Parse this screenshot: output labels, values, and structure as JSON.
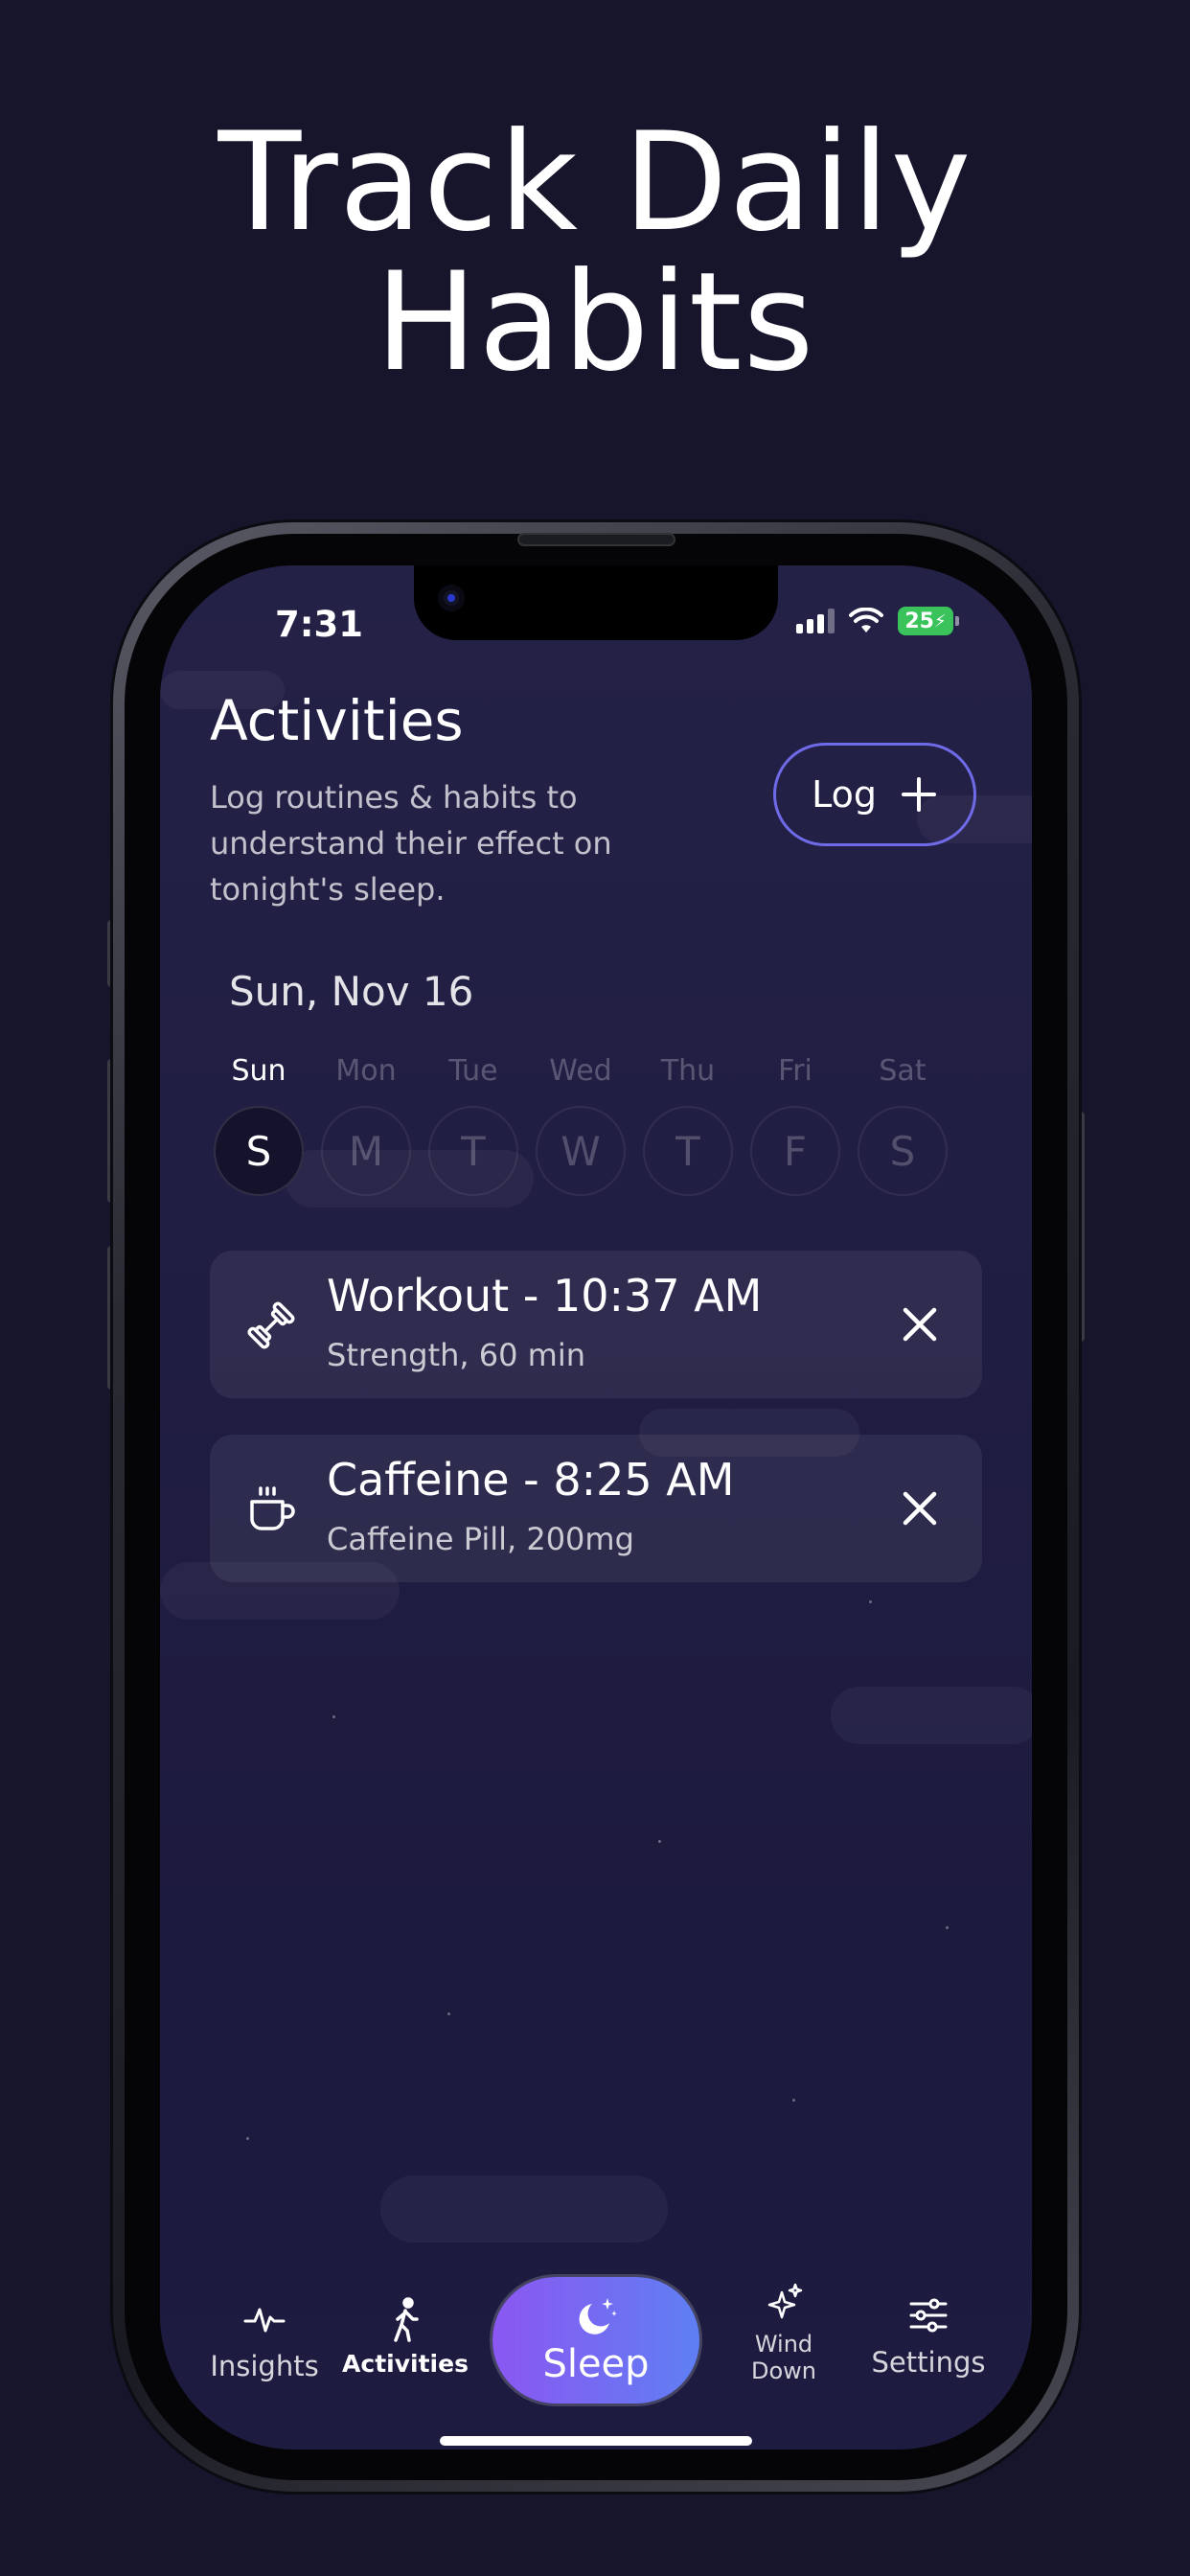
{
  "headline": {
    "line1": "Track Daily",
    "line2": "Habits"
  },
  "status_bar": {
    "time": "7:31",
    "battery": "25"
  },
  "activities": {
    "title": "Activities",
    "subtitle": "Log routines & habits to understand their effect on tonight's sleep.",
    "log_button": "Log"
  },
  "date_label": "Sun, Nov 16",
  "week": [
    {
      "name": "Sun",
      "letter": "S",
      "active": true
    },
    {
      "name": "Mon",
      "letter": "M",
      "active": false
    },
    {
      "name": "Tue",
      "letter": "T",
      "active": false
    },
    {
      "name": "Wed",
      "letter": "W",
      "active": false
    },
    {
      "name": "Thu",
      "letter": "T",
      "active": false
    },
    {
      "name": "Fri",
      "letter": "F",
      "active": false
    },
    {
      "name": "Sat",
      "letter": "S",
      "active": false
    }
  ],
  "entries": [
    {
      "icon": "dumbbell-icon",
      "title": "Workout - 10:37 AM",
      "detail": "Strength, 60 min"
    },
    {
      "icon": "coffee-cup-icon",
      "title": "Caffeine - 8:25 AM",
      "detail": "Caffeine Pill, 200mg"
    }
  ],
  "tabs": {
    "insights": "Insights",
    "activities": "Activities",
    "sleep": "Sleep",
    "wind_down_1": "Wind",
    "wind_down_2": "Down",
    "settings": "Settings"
  },
  "colors": {
    "background": "#16152b",
    "accent_border": "#6f6be8",
    "sleep_gradient_start": "#8b57f2",
    "sleep_gradient_end": "#5f7ff3",
    "battery": "#39c35a"
  }
}
